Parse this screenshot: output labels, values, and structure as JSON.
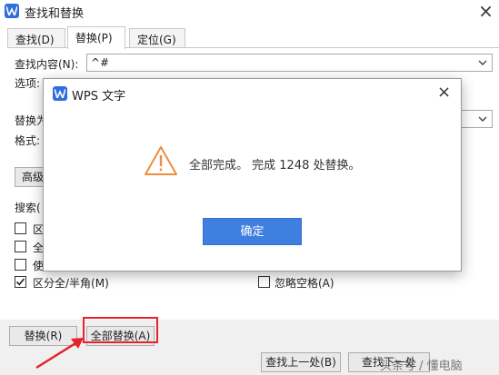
{
  "window": {
    "title": "查找和替换",
    "close_glyph": "×"
  },
  "tabs": [
    {
      "label": "查找(D)"
    },
    {
      "label": "替换(P)"
    },
    {
      "label": "定位(G)"
    }
  ],
  "find": {
    "label": "查找内容(N):",
    "value": "^#"
  },
  "options": {
    "label": "选项:"
  },
  "replace": {
    "label": "替换为",
    "format_label": "格式:"
  },
  "advanced_button": "高级",
  "search": {
    "label": "搜索("
  },
  "checkboxes": [
    {
      "label": "区",
      "checked": false
    },
    {
      "label": "全",
      "checked": false
    },
    {
      "label": "使",
      "checked": false
    },
    {
      "label": "区分全/半角(M)",
      "checked": true
    },
    {
      "label": "忽略空格(A)",
      "checked": false
    }
  ],
  "bottom_buttons": {
    "replace": "替换(R)",
    "replace_all": "全部替换(A)",
    "find_prev": "查找上一处(B)",
    "find_next": "查找下一处"
  },
  "modal": {
    "title": "WPS 文字",
    "message": "全部完成。 完成 1248 处替换。",
    "ok_label": "确定",
    "close_glyph": "×"
  },
  "watermark": "头条号 / 懂电脑",
  "colors": {
    "accent": "#3f7fe0",
    "warning": "#f08c3a",
    "annotation_red": "#e8222a"
  },
  "icons": {
    "app": "wps-writer-icon",
    "warning": "warning-triangle-icon",
    "arrow": "red-annotation-arrow"
  }
}
